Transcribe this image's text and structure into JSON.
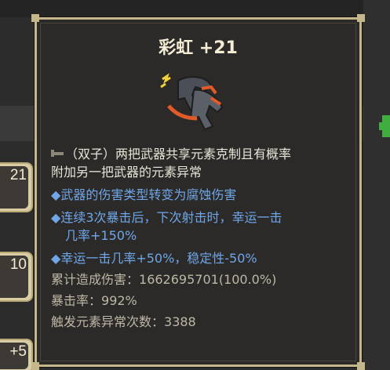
{
  "background": {
    "slots": [
      "21",
      "10",
      "+5"
    ]
  },
  "tooltip": {
    "title": "彩虹 +21",
    "weapon_icon": "rainbow-dual-pistol-icon",
    "description": {
      "icon": "quote-icon",
      "line1": "（双子）两把武器共享元素克制且有概率",
      "line2": "附加另一把武器的元素异常"
    },
    "effects": [
      {
        "bullet": "◆",
        "lines": [
          "武器的伤害类型转变为腐蚀伤害"
        ]
      },
      {
        "bullet": "◆",
        "lines": [
          "连续3次暴击后，下次射击时，幸运一击",
          "几率+150%"
        ]
      },
      {
        "bullet": "◆",
        "lines": [
          "幸运一击几率+50%，稳定性-50%"
        ]
      }
    ],
    "stats": [
      {
        "label": "累计造成伤害：",
        "value": "1662695701(100.0%)"
      },
      {
        "label": "暴击率：",
        "value": "992%"
      },
      {
        "label": "触发元素异常次数：",
        "value": "3388"
      }
    ]
  },
  "colors": {
    "effect_text": "#6fa6e8",
    "stat_text": "#bdb7a6",
    "border": "#c5b68b"
  }
}
